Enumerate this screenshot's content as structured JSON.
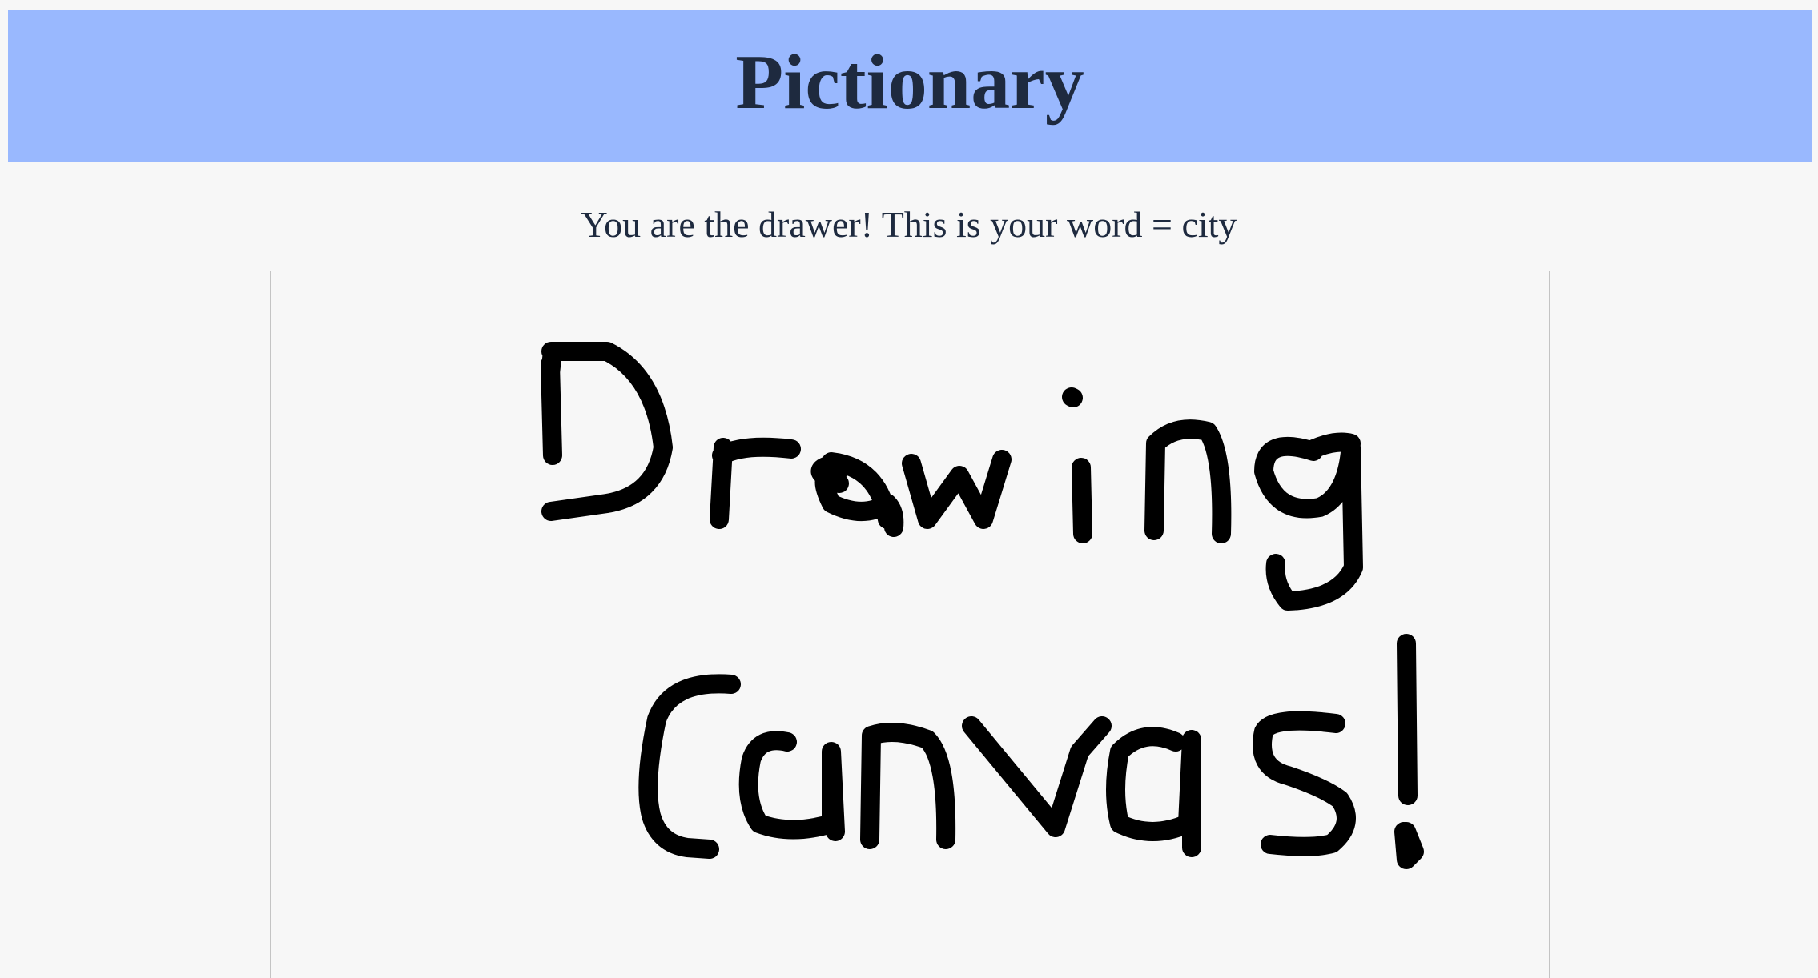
{
  "app": {
    "title": "Pictionary"
  },
  "status": {
    "text": "You are the drawer! This is your word = city"
  },
  "canvas": {
    "ink_color": "#000000",
    "background_color": "#f7f7f7",
    "drawing_text": "Drawing Canvas!"
  },
  "colors": {
    "header_bg": "#99b8fe",
    "page_bg": "#f7f7f7",
    "text": "#1e2a3f"
  }
}
